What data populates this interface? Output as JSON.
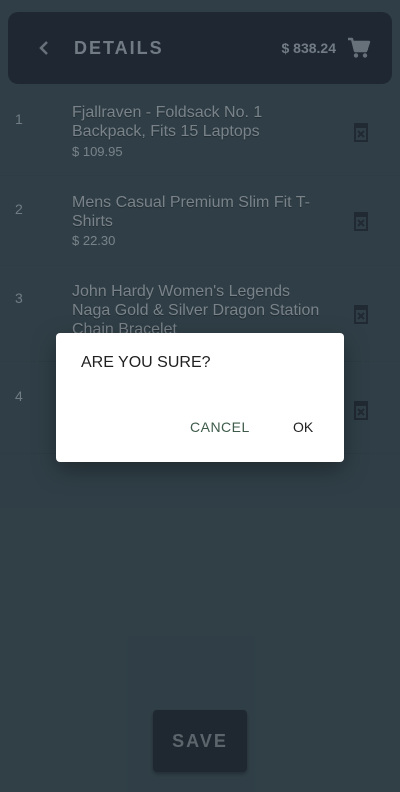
{
  "header": {
    "title": "DETAILS",
    "total": "$ 838.24",
    "back_icon": "chevron-left-icon",
    "cart_icon": "cart-icon"
  },
  "items": [
    {
      "index": "1",
      "name": "Fjallraven - Foldsack No. 1 Backpack, Fits 15 Laptops",
      "price": "$ 109.95"
    },
    {
      "index": "2",
      "name": "Mens Casual Premium Slim Fit T-Shirts",
      "price": "$ 22.30"
    },
    {
      "index": "3",
      "name": "John Hardy Women's Legends Naga Gold & Silver Dragon Station Chain Bracelet",
      "price": ""
    },
    {
      "index": "4",
      "name": "",
      "price": ""
    }
  ],
  "save_label": "SAVE",
  "dialog": {
    "title": "ARE YOU SURE?",
    "cancel_label": "CANCEL",
    "ok_label": "OK"
  },
  "colors": {
    "background": "#37474f",
    "header": "#1c2330",
    "dialog": "#ffffff",
    "cancel_text": "#3e5b4a"
  }
}
